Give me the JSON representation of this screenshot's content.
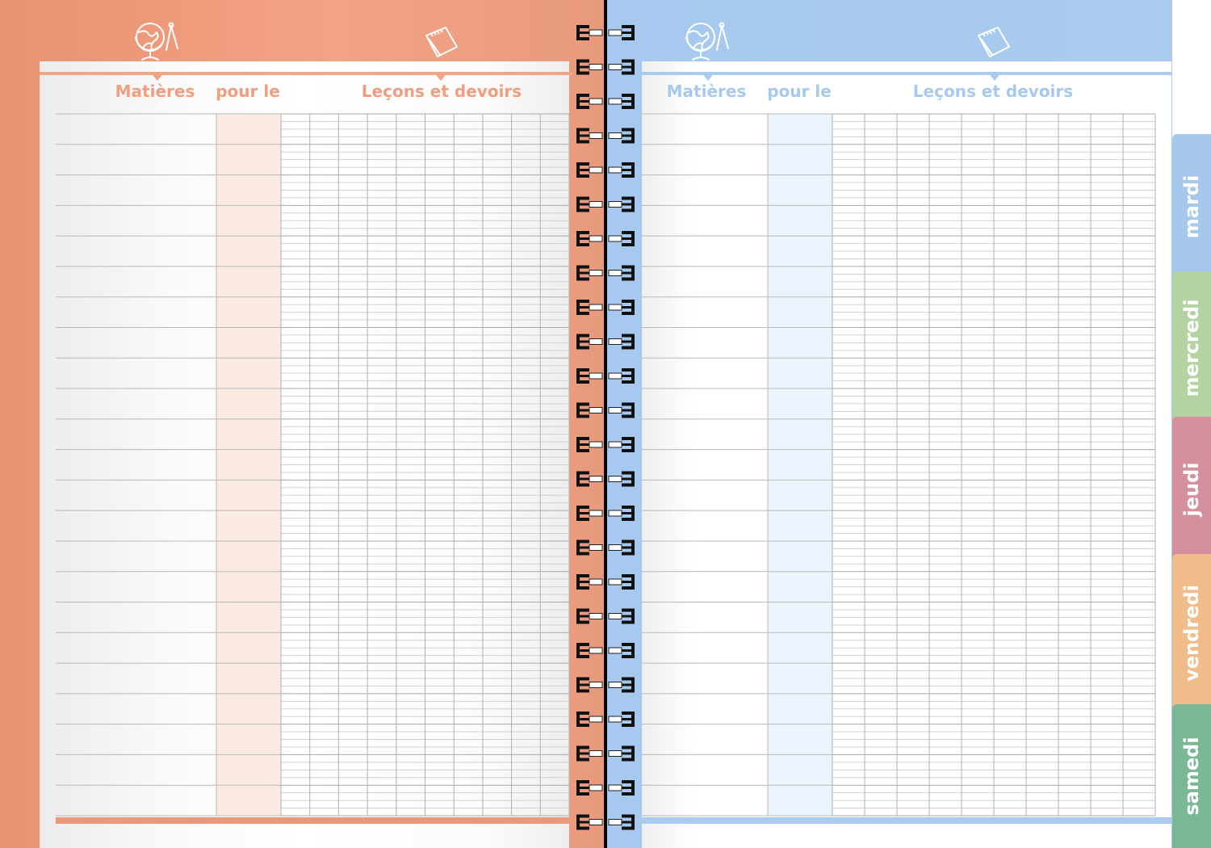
{
  "left_page": {
    "headers": {
      "subjects": "Matières",
      "due": "pour le",
      "lessons": "Leçons et devoirs"
    },
    "accent_color": "#f3a483",
    "column_tint": "#fcebe3",
    "icons": [
      "globe-compass-icon",
      "notebook-icon"
    ]
  },
  "right_page": {
    "headers": {
      "subjects": "Matières",
      "due": "pour le",
      "lessons": "Leçons et devoirs"
    },
    "accent_color": "#a8cbee",
    "column_tint": "#ebf3fc",
    "icons": [
      "globe-compass-icon",
      "notebook-icon"
    ]
  },
  "day_tabs": [
    {
      "label": "mardi",
      "color": "#a6c8ec"
    },
    {
      "label": "mercredi",
      "color": "#b5d2a3"
    },
    {
      "label": "jeudi",
      "color": "#d68f9d"
    },
    {
      "label": "vendredi",
      "color": "#efbc8a"
    },
    {
      "label": "samedi",
      "color": "#7ab794"
    }
  ]
}
